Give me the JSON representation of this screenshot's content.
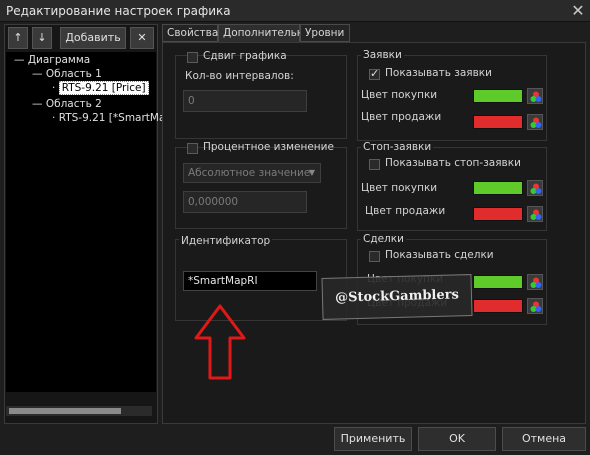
{
  "window": {
    "title": "Редактирование настроек графика"
  },
  "toolbar": {
    "up": "↑",
    "down": "↓",
    "add": "Добавить",
    "remove": "✕"
  },
  "tree": {
    "root": "Диаграмма",
    "area1": "Область 1",
    "item1": "RTS-9.21 [Price]",
    "area2": "Область 2",
    "item2": "RTS-9.21 [*SmartMa"
  },
  "tabs": [
    "Свойства",
    "Дополнительно",
    "Уровни"
  ],
  "shift": {
    "label": "Сдвиг графика",
    "intervals_label": "Кол-во интервалов:",
    "intervals_value": "0"
  },
  "percent": {
    "label": "Процентное изменение",
    "select_value": "Абсолютное значение",
    "value": "0,000000"
  },
  "identifier": {
    "label": "Идентификатор",
    "value": "*SmartMapRI"
  },
  "orders": {
    "title": "Заявки",
    "show": "Показывать заявки",
    "buy_color": "Цвет покупки",
    "sell_color": "Цвет продажи"
  },
  "stop_orders": {
    "title": "Стоп-заявки",
    "show": "Показывать стоп-заявки",
    "buy_color": "Цвет покупки",
    "sell_color": "Цвет продажи"
  },
  "deals": {
    "title": "Сделки",
    "show": "Показывать сделки",
    "buy_color": "Цвет покупки",
    "sell_color": "Цвет продажи"
  },
  "colors": {
    "green": "#5ecb2b",
    "red": "#e02c2c"
  },
  "watermark": "@StockGamblers",
  "buttons": {
    "apply": "Применить",
    "ok": "OK",
    "cancel": "Отмена"
  }
}
